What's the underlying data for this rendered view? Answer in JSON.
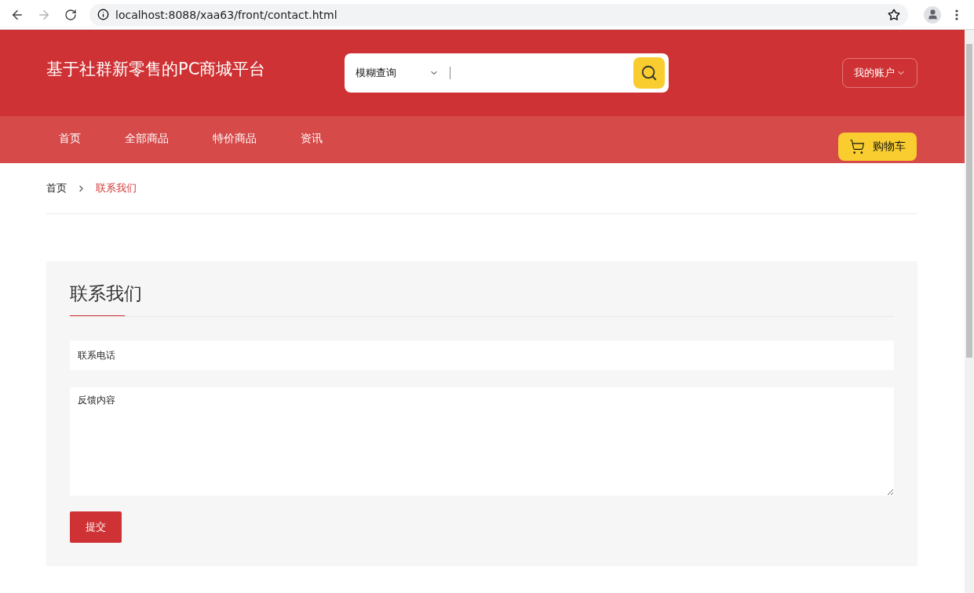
{
  "browser": {
    "url": "localhost:8088/xaa63/front/contact.html",
    "forward_disabled": true
  },
  "header": {
    "title": "基于社群新零售的PC商城平台",
    "search_mode": "模糊查询",
    "account": "我的账户"
  },
  "nav": {
    "items": [
      {
        "label": "首页"
      },
      {
        "label": "全部商品"
      },
      {
        "label": "特价商品"
      },
      {
        "label": "资讯"
      }
    ],
    "cart": "购物车"
  },
  "breadcrumb": [
    {
      "label": "首页",
      "selected": false
    },
    {
      "label": "联系我们",
      "selected": true
    }
  ],
  "form": {
    "title": "联系我们",
    "phone_placeholder": "联系电话",
    "content_placeholder": "反馈内容",
    "submit": "提交"
  }
}
